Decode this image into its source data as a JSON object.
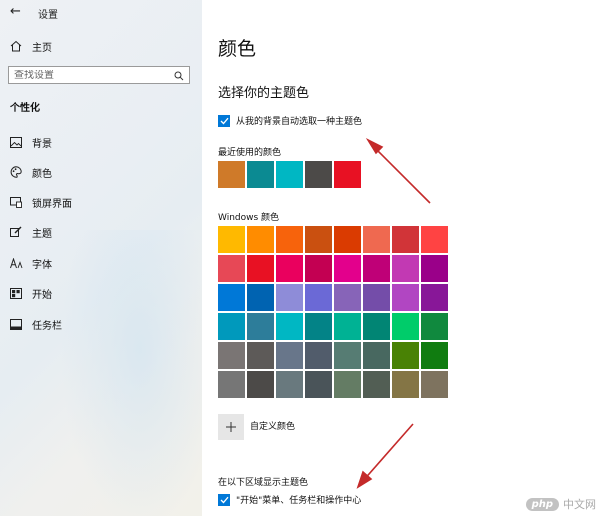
{
  "window": {
    "title": "设置"
  },
  "sidebar": {
    "home_label": "主页",
    "search_placeholder": "查找设置",
    "section_label": "个性化",
    "items": [
      {
        "label": "背景",
        "icon": "picture-icon"
      },
      {
        "label": "颜色",
        "icon": "palette-icon"
      },
      {
        "label": "锁屏界面",
        "icon": "lock-screen-icon"
      },
      {
        "label": "主题",
        "icon": "theme-brush-icon"
      },
      {
        "label": "字体",
        "icon": "font-icon"
      },
      {
        "label": "开始",
        "icon": "start-icon"
      },
      {
        "label": "任务栏",
        "icon": "taskbar-icon"
      }
    ]
  },
  "main": {
    "title": "颜色",
    "accent_heading": "选择你的主题色",
    "auto_pick_label": "从我的背景自动选取一种主题色",
    "auto_pick_checked": true,
    "recent_heading": "最近使用的颜色",
    "recent_colors": [
      "#cf7a29",
      "#0b8a92",
      "#00b7c3",
      "#4c4a48",
      "#e81123"
    ],
    "windows_heading": "Windows 颜色",
    "windows_colors": [
      "#ffb900",
      "#ff8c00",
      "#f7630c",
      "#ca5010",
      "#da3b01",
      "#ef6950",
      "#d13438",
      "#ff4343",
      "#e74856",
      "#e81123",
      "#ea005e",
      "#c30052",
      "#e3008c",
      "#bf0077",
      "#c239b3",
      "#9a0089",
      "#0078d7",
      "#0063b1",
      "#8e8cd8",
      "#6b69d6",
      "#8764b8",
      "#744da9",
      "#b146c2",
      "#881798",
      "#0099bc",
      "#2d7d9a",
      "#00b7c3",
      "#038387",
      "#00b294",
      "#018574",
      "#00cc6a",
      "#10893e",
      "#7a7574",
      "#5d5a58",
      "#68768a",
      "#515c6b",
      "#567c73",
      "#486860",
      "#498205",
      "#107c10",
      "#767676",
      "#4c4a48",
      "#69797e",
      "#4a5459",
      "#647c64",
      "#525e54",
      "#847545",
      "#7e735f"
    ],
    "custom_label": "自定义颜色",
    "show_on_heading": "在以下区域显示主题色",
    "start_taskbar_label": "\"开始\"菜单、任务栏和操作中心",
    "start_taskbar_checked": true
  },
  "watermark": {
    "logo": "php",
    "text": "中文网"
  },
  "colors": {
    "accent": "#0078d7",
    "annotation": "#c42a2a"
  }
}
